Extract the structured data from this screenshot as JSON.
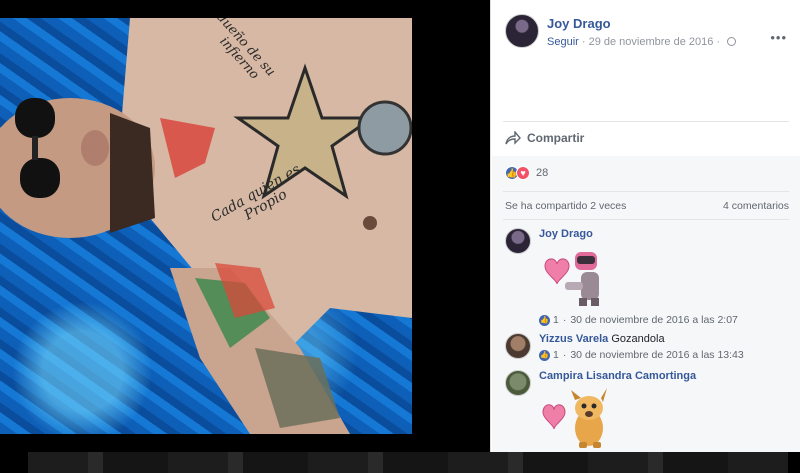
{
  "post": {
    "author": "Joy Drago",
    "follow": "Seguir",
    "separator": "·",
    "date": "29 de noviembre de 2016",
    "separator2": "·",
    "more": "•••",
    "share_label": "Compartir",
    "reaction_count": "28",
    "shared_text": "Se ha compartido 2 veces",
    "comments_text": "4 comentarios"
  },
  "photo": {
    "tattoo_lines": [
      "Cada quien es",
      "Propio",
      "dueño de su",
      "infierno"
    ]
  },
  "comments": [
    {
      "author": "Joy Drago",
      "text": "",
      "likes": "1",
      "dot": "·",
      "time": "30 de noviembre de 2016 a las 2:07"
    },
    {
      "author": "Yizzus Varela",
      "text": "Gozandola",
      "likes": "1",
      "dot": "·",
      "time": "30 de noviembre de 2016 a las 13:43"
    },
    {
      "author": "Campira Lisandra Camortinga",
      "text": ""
    }
  ],
  "colors": {
    "link": "#365899",
    "muted": "#90949c",
    "like": "#4267b2",
    "love": "#f25268"
  }
}
